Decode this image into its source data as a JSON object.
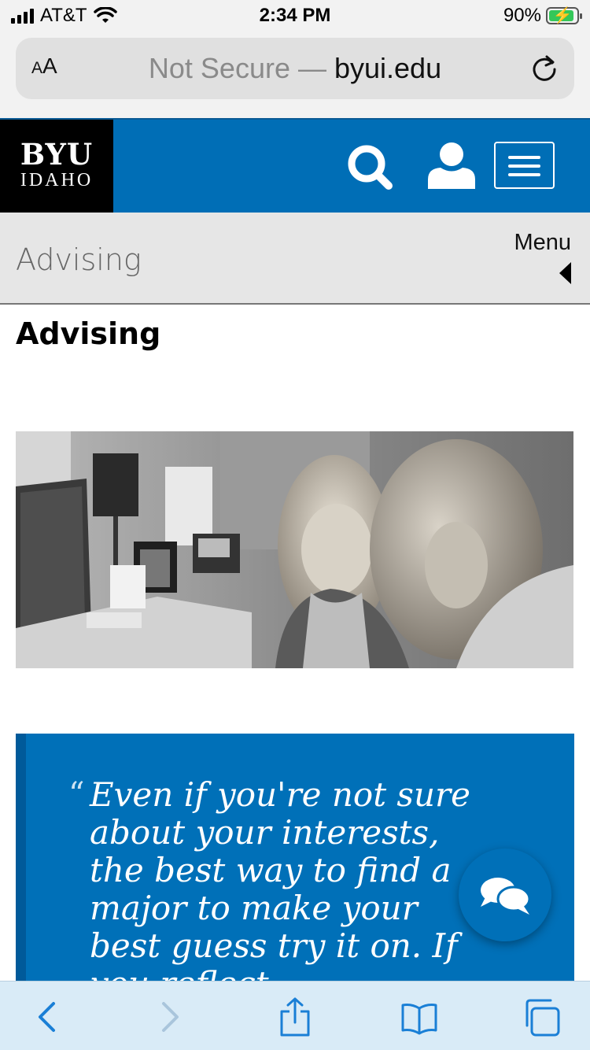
{
  "status_bar": {
    "carrier": "AT&T",
    "time": "2:34 PM",
    "battery_percent": "90%",
    "battery_level": 0.9,
    "battery_color": "#34c759"
  },
  "browser": {
    "text_size_label": "AA",
    "url_prefix": "Not Secure — ",
    "url_domain": "byui.edu",
    "reload_icon": "reload-icon"
  },
  "site_header": {
    "logo_line1": "BYU",
    "logo_line2": "IDAHO",
    "brand_color": "#006eb6",
    "search_icon": "search-icon",
    "account_icon": "user-icon",
    "menu_icon": "hamburger-icon"
  },
  "section_bar": {
    "title": "Advising",
    "menu_label": "Menu"
  },
  "main": {
    "heading": "Advising",
    "photo_alt": "photo",
    "quote_open": "“",
    "quote_text": "Even if you're not sure about your interests, the best way to find a major to make your best guess try it on. If you reflect"
  },
  "chat": {
    "icon": "chat-bubbles-icon"
  },
  "toolbar": {
    "back_icon": "back-icon",
    "forward_icon": "forward-icon",
    "share_icon": "share-icon",
    "bookmarks_icon": "bookmarks-icon",
    "tabs_icon": "tabs-icon"
  }
}
